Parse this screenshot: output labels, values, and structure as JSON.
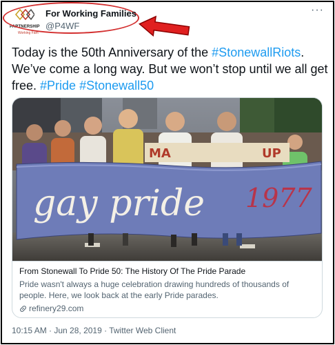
{
  "account": {
    "display_name": "For Working Families",
    "handle": "@P4WF",
    "logo_text": "PARTNERSHIP",
    "logo_subtext": "Working Fam"
  },
  "more_label": "···",
  "tweet": {
    "text_parts": [
      {
        "text": "Today is the 50th Anniversary of the ",
        "kind": "plain"
      },
      {
        "text": "#StonewallRiots",
        "kind": "tag"
      },
      {
        "text": ". We’ve come a long way. But we won’t stop until we all get free. ",
        "kind": "plain"
      },
      {
        "text": "#Pride",
        "kind": "tag"
      },
      {
        "text": " ",
        "kind": "plain"
      },
      {
        "text": "#Stonewall50",
        "kind": "tag"
      }
    ]
  },
  "card": {
    "banner_text": "gay pride",
    "banner_year": "1977",
    "title": "From Stonewall To Pride 50: The History Of The Pride Parade",
    "description": "Pride wasn't always a huge celebration drawing hundreds of thousands of people. Here, we look back at the early Pride parades.",
    "domain": "refinery29.com"
  },
  "meta": "10:15 AM · Jun 28, 2019 · Twitter Web Client",
  "colors": {
    "accent": "#1d9bf0",
    "annotation_red": "#d32f2f",
    "muted": "#536471"
  }
}
